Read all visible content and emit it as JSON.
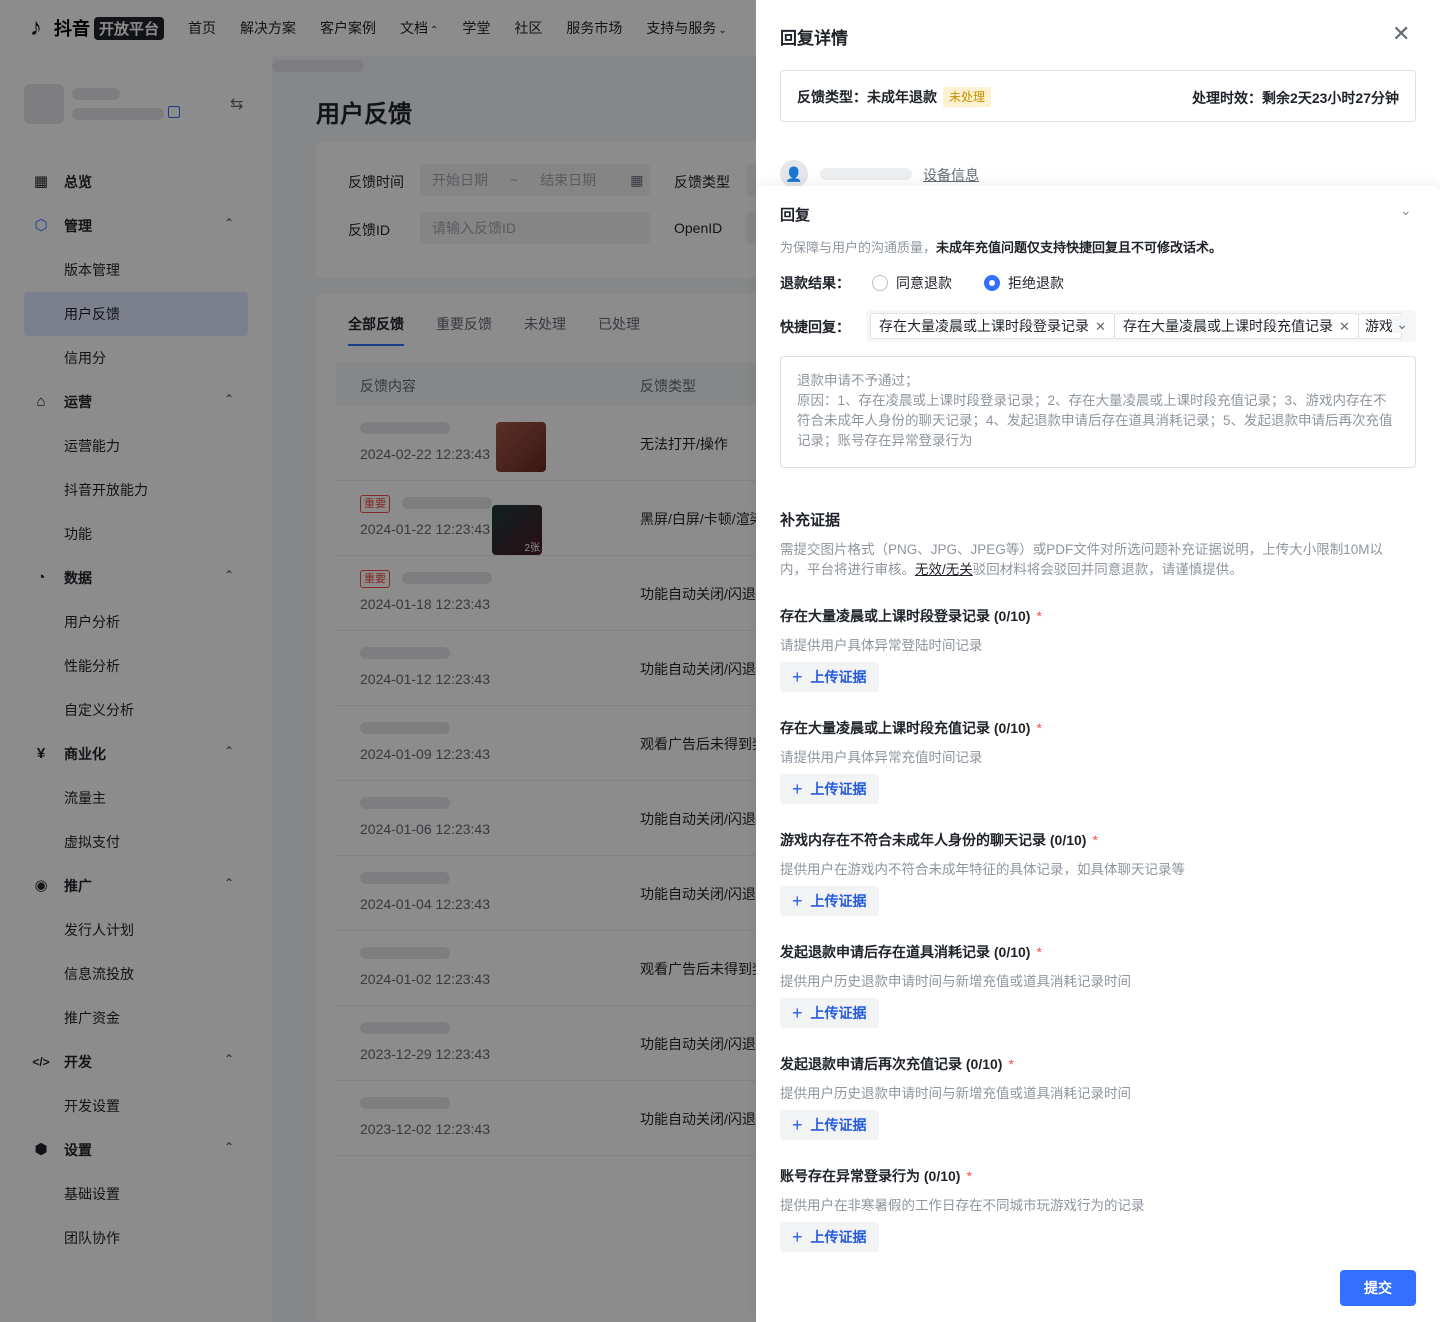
{
  "topnav": {
    "logo_text": "抖音",
    "logo_badge": "开放平台",
    "items": [
      "首页",
      "解决方案",
      "客户案例",
      "文档",
      "学堂",
      "社区",
      "服务市场",
      "支持与服务"
    ]
  },
  "sidebar": {
    "menu": [
      {
        "label": "总览",
        "type": "group",
        "icon": "dashboard-icon"
      },
      {
        "label": "管理",
        "type": "group",
        "icon": "cube-icon"
      },
      {
        "label": "版本管理",
        "type": "sub"
      },
      {
        "label": "用户反馈",
        "type": "sub",
        "active": true
      },
      {
        "label": "信用分",
        "type": "sub"
      },
      {
        "label": "运营",
        "type": "group",
        "icon": "ops-icon"
      },
      {
        "label": "运营能力",
        "type": "sub"
      },
      {
        "label": "抖音开放能力",
        "type": "sub"
      },
      {
        "label": "功能",
        "type": "sub"
      },
      {
        "label": "数据",
        "type": "group",
        "icon": "pie-chart-icon"
      },
      {
        "label": "用户分析",
        "type": "sub"
      },
      {
        "label": "性能分析",
        "type": "sub"
      },
      {
        "label": "自定义分析",
        "type": "sub"
      },
      {
        "label": "商业化",
        "type": "group",
        "icon": "yen-icon"
      },
      {
        "label": "流量主",
        "type": "sub"
      },
      {
        "label": "虚拟支付",
        "type": "sub"
      },
      {
        "label": "推广",
        "type": "group",
        "icon": "broadcast-icon"
      },
      {
        "label": "发行人计划",
        "type": "sub"
      },
      {
        "label": "信息流投放",
        "type": "sub"
      },
      {
        "label": "推广资金",
        "type": "sub"
      },
      {
        "label": "开发",
        "type": "group",
        "icon": "code-icon"
      },
      {
        "label": "开发设置",
        "type": "sub"
      },
      {
        "label": "设置",
        "type": "group",
        "icon": "settings-icon"
      },
      {
        "label": "基础设置",
        "type": "sub"
      },
      {
        "label": "团队协作",
        "type": "sub"
      }
    ]
  },
  "main": {
    "title": "用户反馈",
    "filters": {
      "time_label": "反馈时间",
      "start_placeholder": "开始日期",
      "range_sep": "~",
      "end_placeholder": "结束日期",
      "type_label": "反馈类型",
      "id_label": "反馈ID",
      "id_placeholder": "请输入反馈ID",
      "openid_label": "OpenID"
    },
    "tabs": [
      "全部反馈",
      "重要反馈",
      "未处理",
      "已处理"
    ],
    "columns": [
      "反馈内容",
      "反馈类型"
    ],
    "important_tag": "重要",
    "thumb_count": "2张",
    "rows": [
      {
        "date": "2024-02-22 12:23:43",
        "type": "无法打开/操作"
      },
      {
        "date": "2024-01-22 12:23:43",
        "type": "黑屏/白屏/卡顿/渲染"
      },
      {
        "date": "2024-01-18 12:23:43",
        "type": "功能自动关闭/闪退"
      },
      {
        "date": "2024-01-12 12:23:43",
        "type": "功能自动关闭/闪退"
      },
      {
        "date": "2024-01-09 12:23:43",
        "type": "观看广告后未得到奖励"
      },
      {
        "date": "2024-01-06 12:23:43",
        "type": "功能自动关闭/闪退"
      },
      {
        "date": "2024-01-04 12:23:43",
        "type": "功能自动关闭/闪退"
      },
      {
        "date": "2024-01-02 12:23:43",
        "type": "观看广告后未得到奖励"
      },
      {
        "date": "2023-12-29 12:23:43",
        "type": "功能自动关闭/闪退"
      },
      {
        "date": "2023-12-02 12:23:43",
        "type": "功能自动关闭/闪退"
      }
    ]
  },
  "drawer": {
    "title": "回复详情",
    "close": "✕",
    "info": {
      "feedback_type": "反馈类型：未成年退款",
      "status": "未处理",
      "deadline": "处理时效：剩余2天23小时27分钟"
    },
    "device_link": "设备信息",
    "reply": {
      "title": "回复",
      "desc_prefix": "为保障与用户的沟通质量，",
      "desc_bold": "未成年充值问题仅支持快捷回复且不可修改话术。",
      "refund_label": "退款结果：",
      "options": [
        "同意退款",
        "拒绝退款"
      ],
      "selected": "拒绝退款",
      "quick_label": "快捷回复：",
      "chips": [
        "存在大量凌晨或上课时段登录记录",
        "存在大量凌晨或上课时段充值记录",
        "游戏"
      ],
      "message_line1": "退款申请不予通过；",
      "message_line2": "原因：1、存在凌晨或上课时段登录记录；2、存在大量凌晨或上课时段充值记录；3、游戏内存在不符合未成年人身份的聊天记录；4、发起退款申请后存在道具消耗记录；5、发起退款申请后再次充值记录；账号存在异常登录行为"
    },
    "evidence": {
      "title": "补充证据",
      "desc_1": "需提交图片格式（PNG、JPG、JPEG等）或PDF文件对所选问题补充证据说明，上传大小限制10M以内，平台将进行审核。",
      "desc_link": "无效/无关",
      "desc_2": "驳回材料将会驳回并同意退款，请谨慎提供。",
      "upload_label": "上传证据",
      "items": [
        {
          "name": "存在大量凌晨或上课时段登录记录 (0/10)",
          "hint": "请提供用户具体异常登陆时间记录"
        },
        {
          "name": "存在大量凌晨或上课时段充值记录 (0/10)",
          "hint": "请提供用户具体异常充值时间记录"
        },
        {
          "name": "游戏内存在不符合未成年人身份的聊天记录 (0/10)",
          "hint": "提供用户在游戏内不符合未成年特征的具体记录，如具体聊天记录等"
        },
        {
          "name": "发起退款申请后存在道具消耗记录 (0/10)",
          "hint": "提供用户历史退款申请时间与新增充值或道具消耗记录时间"
        },
        {
          "name": "发起退款申请后再次充值记录 (0/10)",
          "hint": "提供用户历史退款申请时间与新增充值或道具消耗记录时间"
        },
        {
          "name": "账号存在异常登录行为 (0/10)",
          "hint": "提供用户在非寒暑假的工作日存在不同城市玩游戏行为的记录"
        }
      ]
    },
    "submit": "提交"
  }
}
